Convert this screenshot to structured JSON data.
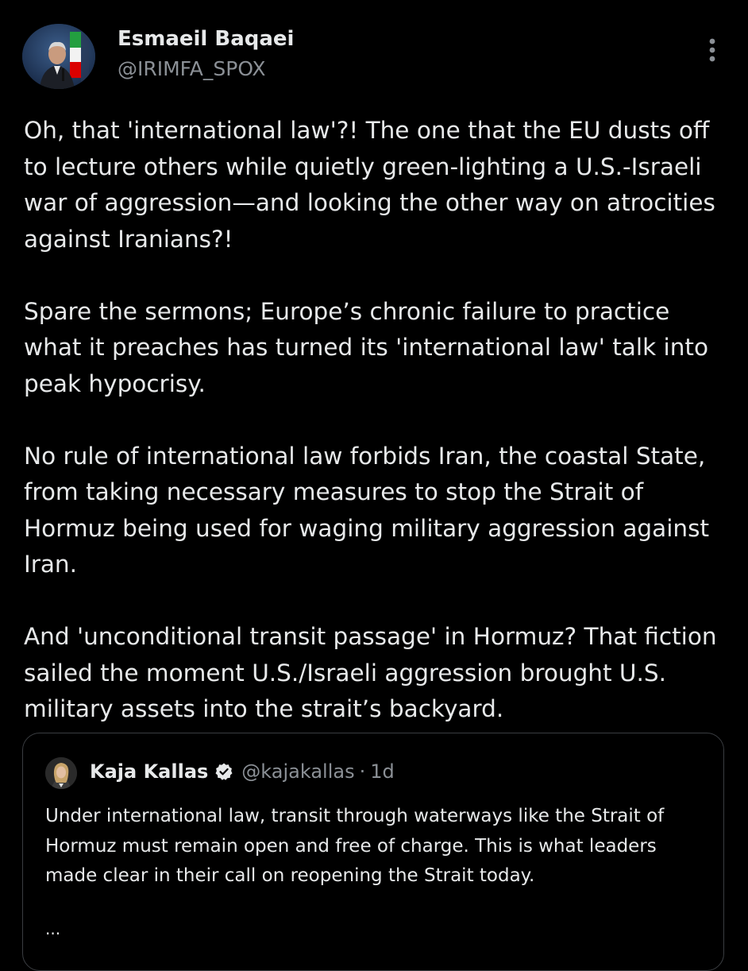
{
  "post": {
    "author": {
      "name": "Esmaeil Baqaei",
      "handle": "@IRIMFA_SPOX"
    },
    "paragraphs": [
      "Oh, that 'international law'?! The one that the EU dusts off to lecture others while quietly green-lighting a U.S.-Israeli war of aggression—and looking the other way on atrocities against Iranians?!",
      "Spare the sermons; Europe’s chronic failure to practice what it preaches has turned its 'international law' talk into peak hypocrisy.",
      "No rule of international law forbids Iran, the coastal State, from taking necessary measures to stop the Strait of Hormuz being used for waging military aggression against Iran.",
      "And 'unconditional transit passage' in Hormuz? That fiction sailed the moment U.S./Israeli aggression brought U.S. military assets into the strait’s backyard."
    ]
  },
  "quoted_post": {
    "author": {
      "name": "Kaja Kallas",
      "handle": "@kajakallas",
      "verified_icon": "verified-badge-icon"
    },
    "separator": "·",
    "time": "1d",
    "text": "Under international law, transit through waterways like the Strait of Hormuz must remain open and free of charge. This is what leaders made clear in their call on reopening the Strait today.",
    "truncation": "..."
  },
  "icons": {
    "more": "more-vertical-icon"
  },
  "colors": {
    "background": "#000000",
    "text_primary": "#e7e9ea",
    "text_secondary": "#8b9096",
    "quote_border": "#3a3d41"
  }
}
